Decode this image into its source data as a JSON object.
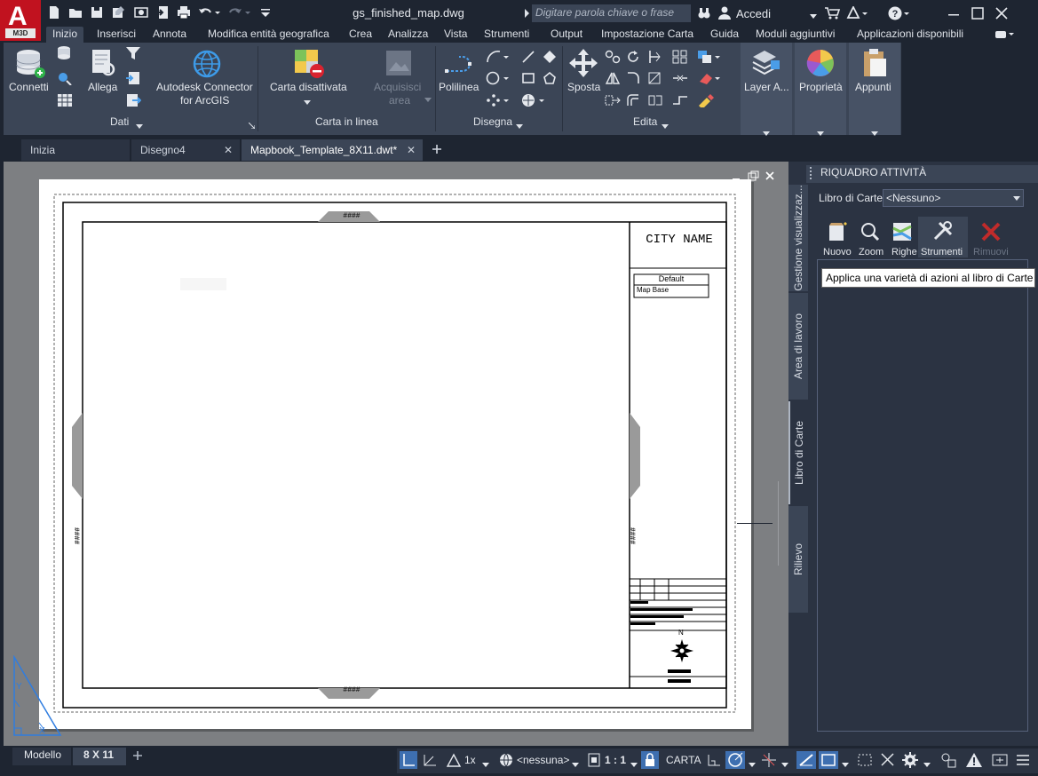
{
  "titlebar": {
    "logo_letter": "A",
    "logo_badge": "M3D",
    "document_title": "gs_finished_map.dwg",
    "search_placeholder": "Digitare parola chiave o frase",
    "signin_label": "Accedi"
  },
  "ribbon_tabs": [
    "Inizio",
    "Inserisci",
    "Annota",
    "Modifica entità geografica",
    "Crea",
    "Analizza",
    "Vista",
    "Strumenti",
    "Output",
    "Impostazione Carta",
    "Guida",
    "Moduli aggiuntivi",
    "Applicazioni disponibili"
  ],
  "ribbon": {
    "connetti": "Connetti",
    "allega": "Allega",
    "connector_line1": "Autodesk Connector",
    "connector_line2": "for ArcGIS",
    "carta_disattivata": "Carta disattivata",
    "acquisisci_line1": "Acquisisci",
    "acquisisci_line2": "area",
    "polilinea": "Polilinea",
    "sposta": "Sposta",
    "layer": "Layer A...",
    "proprieta": "Proprietà",
    "appunti": "Appunti",
    "panel_dati": "Dati",
    "panel_carta": "Carta in linea",
    "panel_disegna": "Disegna",
    "panel_edita": "Edita"
  },
  "doc_tabs": [
    {
      "label": "Inizia",
      "closable": false
    },
    {
      "label": "Disegno4",
      "closable": true
    },
    {
      "label": "Mapbook_Template_8X11.dwt*",
      "closable": true
    }
  ],
  "drawing": {
    "city_name": "CITY NAME",
    "legend_default": "Default",
    "legend_map_base": "Map Base",
    "marker_text": "####",
    "north_label": "N"
  },
  "palette": {
    "title": "RIQUADRO ATTIVITÀ",
    "libro_label": "Libro di Carte",
    "libro_value": "<Nessuno>",
    "tools": [
      {
        "label": "Nuovo",
        "enabled": true
      },
      {
        "label": "Zoom",
        "enabled": true
      },
      {
        "label": "Righe",
        "enabled": true
      },
      {
        "label": "Strumenti",
        "enabled": true
      },
      {
        "label": "Rimuovi",
        "enabled": false
      }
    ],
    "tooltip": "Applica una varietà di azioni al libro di Carte",
    "side_tabs": [
      "Gestione visualizzaz...",
      "Area di lavoro",
      "Libro di Carte",
      "Rilievo"
    ]
  },
  "statusbar": {
    "modello": "Modello",
    "layout": "8 X 11",
    "scale_annot": "1x",
    "coord_system": "<nessuna>",
    "scale": "1 : 1",
    "carta": "CARTA"
  },
  "colors": {
    "accent_red": "#c1121f",
    "ribbon_bg": "#3b4556",
    "app_bg": "#1e2531"
  }
}
